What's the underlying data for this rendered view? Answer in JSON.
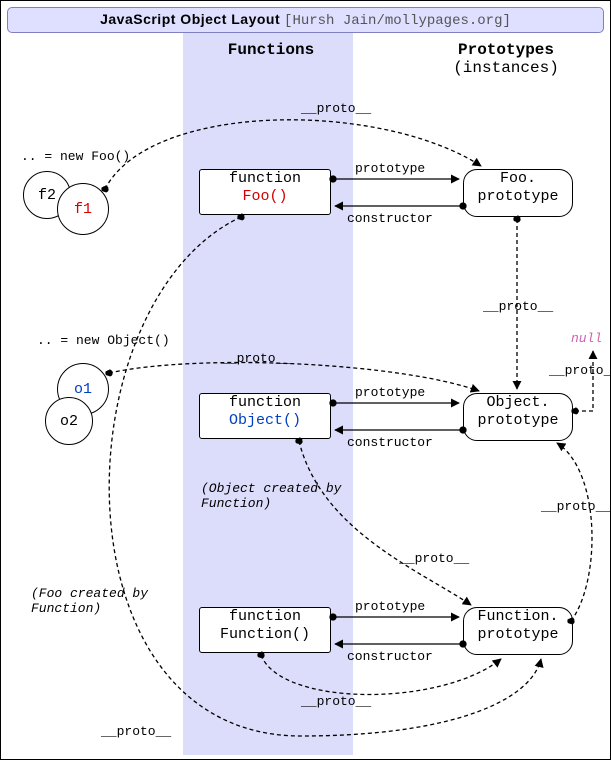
{
  "title": {
    "main": "JavaScript Object Layout",
    "sub": "[Hursh Jain/mollypages.org]"
  },
  "columns": {
    "functions": "Functions",
    "prototypes": "Prototypes",
    "prototypes_sub": "(instances)"
  },
  "labels": {
    "proto": "__proto__",
    "prototype": "prototype",
    "constructor": "constructor",
    "null": "null",
    "new_foo": ".. = new Foo()",
    "new_obj": ".. = new Object()",
    "obj_created": "(Object created by\nFunction)",
    "foo_created": "(Foo created\nby Function)"
  },
  "nodes": {
    "fn_foo": {
      "l1": "function",
      "l2": "Foo()"
    },
    "fn_object": {
      "l1": "function",
      "l2": "Object()"
    },
    "fn_function": {
      "l1": "function",
      "l2": "Function()"
    },
    "p_foo": {
      "l1": "Foo.",
      "l2": "prototype"
    },
    "p_object": {
      "l1": "Object.",
      "l2": "prototype"
    },
    "p_function": {
      "l1": "Function.",
      "l2": "prototype"
    },
    "f1": "f1",
    "f2": "f2",
    "o1": "o1",
    "o2": "o2"
  }
}
